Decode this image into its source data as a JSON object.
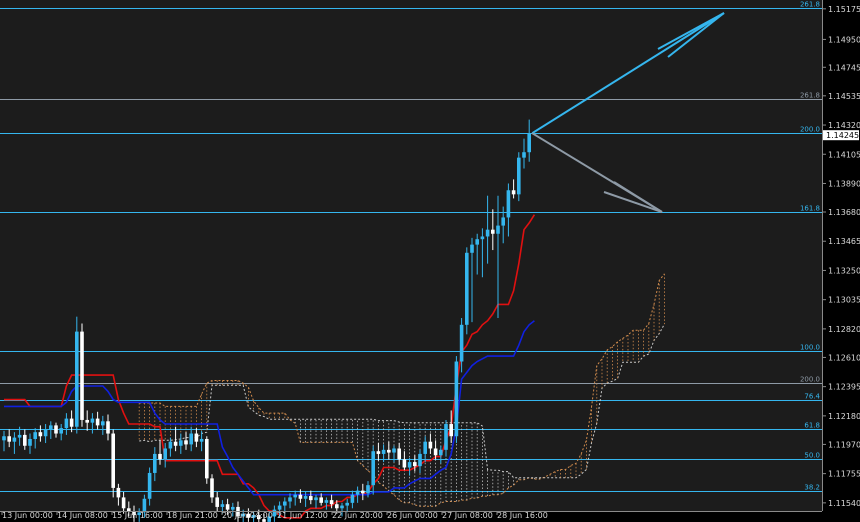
{
  "chart_data": {
    "type": "candlestick",
    "ylim": [
      1.1148,
      1.1524
    ],
    "y_ticks": [
      "1.15175",
      "1.14950",
      "1.14745",
      "1.14535",
      "1.14320",
      "1.14105",
      "1.13890",
      "1.13680",
      "1.13465",
      "1.13250",
      "1.13035",
      "1.12820",
      "1.12610",
      "1.12395",
      "1.12180",
      "1.11970",
      "1.11755",
      "1.11540"
    ],
    "current_price": "1.14245",
    "x_labels": [
      "13 Jun 00:00",
      "14 Jun 08:00",
      "15 Jun 16:00",
      "18 Jun 21:00",
      "20 Jun 04:00",
      "21 Jun 12:00",
      "22 Jun 20:00",
      "26 Jun 00:00",
      "27 Jun 08:00",
      "28 Jun 16:00"
    ],
    "fib_levels": [
      {
        "label": "261.8",
        "price": 1.1518,
        "color": "#35b6ee"
      },
      {
        "label": "261.8",
        "price": 1.1451,
        "color": "#8e9aa6"
      },
      {
        "label": "200.0",
        "price": 1.1426,
        "color": "#35b6ee"
      },
      {
        "label": "161.8",
        "price": 1.1368,
        "color": "#35b6ee"
      },
      {
        "label": "100.0",
        "price": 1.1266,
        "color": "#35b6ee"
      },
      {
        "label": "200.0",
        "price": 1.1242,
        "color": "#8e9aa6"
      },
      {
        "label": "76.4",
        "price": 1.123,
        "color": "#35b6ee"
      },
      {
        "label": "61.8",
        "price": 1.1208,
        "color": "#35b6ee"
      },
      {
        "label": "50.0",
        "price": 1.1186,
        "color": "#35b6ee"
      },
      {
        "label": "38.2",
        "price": 1.1163,
        "color": "#35b6ee"
      }
    ],
    "candles": [
      {
        "o": 1.12,
        "h": 1.1207,
        "l": 1.1192,
        "c": 1.1203
      },
      {
        "o": 1.1203,
        "h": 1.1208,
        "l": 1.1195,
        "c": 1.1199
      },
      {
        "o": 1.1199,
        "h": 1.1206,
        "l": 1.119,
        "c": 1.1202
      },
      {
        "o": 1.1202,
        "h": 1.121,
        "l": 1.1196,
        "c": 1.1204
      },
      {
        "o": 1.1204,
        "h": 1.1208,
        "l": 1.1193,
        "c": 1.1196
      },
      {
        "o": 1.1196,
        "h": 1.1205,
        "l": 1.119,
        "c": 1.1201
      },
      {
        "o": 1.1201,
        "h": 1.1209,
        "l": 1.1194,
        "c": 1.1206
      },
      {
        "o": 1.1206,
        "h": 1.1211,
        "l": 1.1199,
        "c": 1.1203
      },
      {
        "o": 1.1203,
        "h": 1.1212,
        "l": 1.1198,
        "c": 1.1208
      },
      {
        "o": 1.1208,
        "h": 1.1214,
        "l": 1.1201,
        "c": 1.1211
      },
      {
        "o": 1.1211,
        "h": 1.1213,
        "l": 1.1202,
        "c": 1.1205
      },
      {
        "o": 1.1205,
        "h": 1.1212,
        "l": 1.12,
        "c": 1.1209
      },
      {
        "o": 1.1209,
        "h": 1.122,
        "l": 1.1204,
        "c": 1.1216
      },
      {
        "o": 1.1216,
        "h": 1.1222,
        "l": 1.1206,
        "c": 1.121
      },
      {
        "o": 1.121,
        "h": 1.1291,
        "l": 1.1205,
        "c": 1.128
      },
      {
        "o": 1.128,
        "h": 1.1286,
        "l": 1.121,
        "c": 1.1215
      },
      {
        "o": 1.1215,
        "h": 1.1222,
        "l": 1.1207,
        "c": 1.1213
      },
      {
        "o": 1.1213,
        "h": 1.122,
        "l": 1.1205,
        "c": 1.1216
      },
      {
        "o": 1.1216,
        "h": 1.1221,
        "l": 1.1208,
        "c": 1.1211
      },
      {
        "o": 1.1211,
        "h": 1.1218,
        "l": 1.1204,
        "c": 1.1214
      },
      {
        "o": 1.1214,
        "h": 1.1219,
        "l": 1.12,
        "c": 1.1205
      },
      {
        "o": 1.1205,
        "h": 1.1208,
        "l": 1.1158,
        "c": 1.1165
      },
      {
        "o": 1.1165,
        "h": 1.1168,
        "l": 1.1152,
        "c": 1.1158
      },
      {
        "o": 1.1158,
        "h": 1.1162,
        "l": 1.1146,
        "c": 1.115
      },
      {
        "o": 1.115,
        "h": 1.1155,
        "l": 1.1144,
        "c": 1.1148
      },
      {
        "o": 1.1148,
        "h": 1.1152,
        "l": 1.114,
        "c": 1.1145
      },
      {
        "o": 1.1145,
        "h": 1.115,
        "l": 1.114,
        "c": 1.1147
      },
      {
        "o": 1.1147,
        "h": 1.116,
        "l": 1.1143,
        "c": 1.1157
      },
      {
        "o": 1.1157,
        "h": 1.118,
        "l": 1.1152,
        "c": 1.1176
      },
      {
        "o": 1.1176,
        "h": 1.1195,
        "l": 1.117,
        "c": 1.119
      },
      {
        "o": 1.119,
        "h": 1.12,
        "l": 1.1182,
        "c": 1.1186
      },
      {
        "o": 1.1186,
        "h": 1.1198,
        "l": 1.118,
        "c": 1.1194
      },
      {
        "o": 1.1194,
        "h": 1.1202,
        "l": 1.1188,
        "c": 1.1199
      },
      {
        "o": 1.1199,
        "h": 1.121,
        "l": 1.1192,
        "c": 1.1196
      },
      {
        "o": 1.1196,
        "h": 1.1205,
        "l": 1.119,
        "c": 1.12
      },
      {
        "o": 1.12,
        "h": 1.1206,
        "l": 1.1193,
        "c": 1.1197
      },
      {
        "o": 1.1197,
        "h": 1.121,
        "l": 1.1192,
        "c": 1.1205
      },
      {
        "o": 1.1205,
        "h": 1.1209,
        "l": 1.1195,
        "c": 1.1199
      },
      {
        "o": 1.1199,
        "h": 1.1207,
        "l": 1.1192,
        "c": 1.1201
      },
      {
        "o": 1.1201,
        "h": 1.1203,
        "l": 1.1168,
        "c": 1.1172
      },
      {
        "o": 1.1172,
        "h": 1.1175,
        "l": 1.1154,
        "c": 1.1158
      },
      {
        "o": 1.1158,
        "h": 1.1162,
        "l": 1.1148,
        "c": 1.1151
      },
      {
        "o": 1.1151,
        "h": 1.1156,
        "l": 1.1146,
        "c": 1.1153
      },
      {
        "o": 1.1153,
        "h": 1.1157,
        "l": 1.1145,
        "c": 1.1149
      },
      {
        "o": 1.1149,
        "h": 1.1154,
        "l": 1.1144,
        "c": 1.1151
      },
      {
        "o": 1.1151,
        "h": 1.1155,
        "l": 1.114,
        "c": 1.1144
      },
      {
        "o": 1.1144,
        "h": 1.1149,
        "l": 1.1138,
        "c": 1.1146
      },
      {
        "o": 1.1146,
        "h": 1.115,
        "l": 1.114,
        "c": 1.1143
      },
      {
        "o": 1.1143,
        "h": 1.1148,
        "l": 1.1138,
        "c": 1.1145
      },
      {
        "o": 1.1145,
        "h": 1.1149,
        "l": 1.1139,
        "c": 1.1142
      },
      {
        "o": 1.1142,
        "h": 1.1146,
        "l": 1.1136,
        "c": 1.114
      },
      {
        "o": 1.114,
        "h": 1.1147,
        "l": 1.1135,
        "c": 1.1144
      },
      {
        "o": 1.1144,
        "h": 1.1152,
        "l": 1.114,
        "c": 1.1149
      },
      {
        "o": 1.1149,
        "h": 1.1155,
        "l": 1.1143,
        "c": 1.1152
      },
      {
        "o": 1.1152,
        "h": 1.1158,
        "l": 1.1146,
        "c": 1.1155
      },
      {
        "o": 1.1155,
        "h": 1.1161,
        "l": 1.115,
        "c": 1.1158
      },
      {
        "o": 1.1158,
        "h": 1.1163,
        "l": 1.1152,
        "c": 1.116
      },
      {
        "o": 1.116,
        "h": 1.1164,
        "l": 1.1154,
        "c": 1.1157
      },
      {
        "o": 1.1157,
        "h": 1.1162,
        "l": 1.1151,
        "c": 1.1159
      },
      {
        "o": 1.1159,
        "h": 1.1163,
        "l": 1.1153,
        "c": 1.1156
      },
      {
        "o": 1.1156,
        "h": 1.116,
        "l": 1.115,
        "c": 1.1158
      },
      {
        "o": 1.1158,
        "h": 1.1161,
        "l": 1.1152,
        "c": 1.1154
      },
      {
        "o": 1.1154,
        "h": 1.1158,
        "l": 1.1149,
        "c": 1.1156
      },
      {
        "o": 1.1156,
        "h": 1.116,
        "l": 1.115,
        "c": 1.1153
      },
      {
        "o": 1.1153,
        "h": 1.1156,
        "l": 1.1146,
        "c": 1.115
      },
      {
        "o": 1.115,
        "h": 1.1154,
        "l": 1.1144,
        "c": 1.1152
      },
      {
        "o": 1.1152,
        "h": 1.1157,
        "l": 1.1147,
        "c": 1.1154
      },
      {
        "o": 1.1154,
        "h": 1.1163,
        "l": 1.115,
        "c": 1.116
      },
      {
        "o": 1.116,
        "h": 1.1166,
        "l": 1.1154,
        "c": 1.1163
      },
      {
        "o": 1.1163,
        "h": 1.1168,
        "l": 1.1156,
        "c": 1.1161
      },
      {
        "o": 1.1161,
        "h": 1.117,
        "l": 1.1158,
        "c": 1.1167
      },
      {
        "o": 1.1167,
        "h": 1.1196,
        "l": 1.116,
        "c": 1.1192
      },
      {
        "o": 1.1192,
        "h": 1.1198,
        "l": 1.1185,
        "c": 1.119
      },
      {
        "o": 1.119,
        "h": 1.1197,
        "l": 1.1184,
        "c": 1.1193
      },
      {
        "o": 1.1193,
        "h": 1.1199,
        "l": 1.1186,
        "c": 1.1191
      },
      {
        "o": 1.1191,
        "h": 1.1196,
        "l": 1.1184,
        "c": 1.1194
      },
      {
        "o": 1.1194,
        "h": 1.1198,
        "l": 1.1182,
        "c": 1.1186
      },
      {
        "o": 1.1186,
        "h": 1.1192,
        "l": 1.1178,
        "c": 1.118
      },
      {
        "o": 1.118,
        "h": 1.1187,
        "l": 1.1174,
        "c": 1.1184
      },
      {
        "o": 1.1184,
        "h": 1.1189,
        "l": 1.1177,
        "c": 1.1181
      },
      {
        "o": 1.1181,
        "h": 1.1193,
        "l": 1.1176,
        "c": 1.119
      },
      {
        "o": 1.119,
        "h": 1.1203,
        "l": 1.1184,
        "c": 1.1199
      },
      {
        "o": 1.1199,
        "h": 1.1205,
        "l": 1.119,
        "c": 1.1194
      },
      {
        "o": 1.1194,
        "h": 1.12,
        "l": 1.1186,
        "c": 1.1189
      },
      {
        "o": 1.1189,
        "h": 1.1196,
        "l": 1.1183,
        "c": 1.1193
      },
      {
        "o": 1.1193,
        "h": 1.1215,
        "l": 1.1188,
        "c": 1.1212
      },
      {
        "o": 1.1212,
        "h": 1.1222,
        "l": 1.1198,
        "c": 1.1203
      },
      {
        "o": 1.1203,
        "h": 1.1262,
        "l": 1.1198,
        "c": 1.1258
      },
      {
        "o": 1.1258,
        "h": 1.129,
        "l": 1.125,
        "c": 1.1285
      },
      {
        "o": 1.1285,
        "h": 1.1342,
        "l": 1.1278,
        "c": 1.1338
      },
      {
        "o": 1.1338,
        "h": 1.1349,
        "l": 1.1287,
        "c": 1.1344
      },
      {
        "o": 1.1344,
        "h": 1.1352,
        "l": 1.1322,
        "c": 1.1348
      },
      {
        "o": 1.1348,
        "h": 1.1356,
        "l": 1.132,
        "c": 1.135
      },
      {
        "o": 1.135,
        "h": 1.138,
        "l": 1.133,
        "c": 1.1355
      },
      {
        "o": 1.1355,
        "h": 1.137,
        "l": 1.134,
        "c": 1.1352
      },
      {
        "o": 1.1352,
        "h": 1.138,
        "l": 1.129,
        "c": 1.1358
      },
      {
        "o": 1.1358,
        "h": 1.1372,
        "l": 1.1345,
        "c": 1.1364
      },
      {
        "o": 1.1364,
        "h": 1.1389,
        "l": 1.135,
        "c": 1.1384
      },
      {
        "o": 1.1384,
        "h": 1.1392,
        "l": 1.1378,
        "c": 1.1381
      },
      {
        "o": 1.1381,
        "h": 1.1412,
        "l": 1.1376,
        "c": 1.1408
      },
      {
        "o": 1.1408,
        "h": 1.1422,
        "l": 1.14,
        "c": 1.1412
      },
      {
        "o": 1.1412,
        "h": 1.1436,
        "l": 1.1405,
        "c": 1.1426
      }
    ],
    "tenkan_sen": [
      1.123,
      1.123,
      1.123,
      1.123,
      1.123,
      1.1225,
      1.1225,
      1.1225,
      1.1225,
      1.1225,
      1.1225,
      1.1225,
      1.124,
      1.1248,
      1.1248,
      1.1248,
      1.1248,
      1.1248,
      1.1248,
      1.1248,
      1.1248,
      1.1248,
      1.123,
      1.122,
      1.1212,
      1.1212,
      1.1212,
      1.1212,
      1.1212,
      1.121,
      1.121,
      1.1185,
      1.1185,
      1.1185,
      1.1185,
      1.1185,
      1.1185,
      1.1185,
      1.1185,
      1.1185,
      1.1185,
      1.1185,
      1.1175,
      1.1175,
      1.1175,
      1.1175,
      1.1168,
      1.1168,
      1.1165,
      1.116,
      1.1152,
      1.1148,
      1.1148,
      1.1145,
      1.1143,
      1.1143,
      1.1143,
      1.1143,
      1.1148,
      1.115,
      1.115,
      1.115,
      1.1152,
      1.1152,
      1.1155,
      1.1155,
      1.1158,
      1.1158,
      1.116,
      1.116,
      1.1162,
      1.1168,
      1.1172,
      1.118,
      1.118,
      1.118,
      1.1178,
      1.1178,
      1.1178,
      1.118,
      1.1182,
      1.1185,
      1.1185,
      1.1188,
      1.1188,
      1.12,
      1.121,
      1.124,
      1.1265,
      1.127,
      1.1278,
      1.128,
      1.1285,
      1.1288,
      1.1293,
      1.13,
      1.13,
      1.13,
      1.131,
      1.133,
      1.1355,
      1.136,
      1.1366
    ],
    "kijun_sen": [
      1.1225,
      1.1225,
      1.1225,
      1.1225,
      1.1225,
      1.1225,
      1.1225,
      1.1225,
      1.1225,
      1.1225,
      1.1225,
      1.1225,
      1.1228,
      1.1236,
      1.124,
      1.124,
      1.124,
      1.124,
      1.124,
      1.124,
      1.1236,
      1.123,
      1.1228,
      1.1228,
      1.1228,
      1.1228,
      1.1228,
      1.1228,
      1.1228,
      1.122,
      1.1215,
      1.1212,
      1.1212,
      1.1212,
      1.1212,
      1.1212,
      1.1212,
      1.1212,
      1.1212,
      1.1212,
      1.1212,
      1.1212,
      1.1195,
      1.1188,
      1.118,
      1.1175,
      1.117,
      1.1165,
      1.116,
      1.116,
      1.116,
      1.116,
      1.116,
      1.116,
      1.116,
      1.116,
      1.116,
      1.116,
      1.116,
      1.116,
      1.116,
      1.116,
      1.116,
      1.116,
      1.116,
      1.116,
      1.116,
      1.116,
      1.116,
      1.116,
      1.116,
      1.1162,
      1.1162,
      1.1162,
      1.1162,
      1.1165,
      1.1165,
      1.1165,
      1.1168,
      1.117,
      1.1172,
      1.1172,
      1.1172,
      1.1175,
      1.1178,
      1.118,
      1.119,
      1.121,
      1.1245,
      1.125,
      1.1255,
      1.1258,
      1.126,
      1.1262,
      1.1262,
      1.1262,
      1.1262,
      1.1262,
      1.1262,
      1.127,
      1.128,
      1.1285,
      1.1288
    ]
  }
}
